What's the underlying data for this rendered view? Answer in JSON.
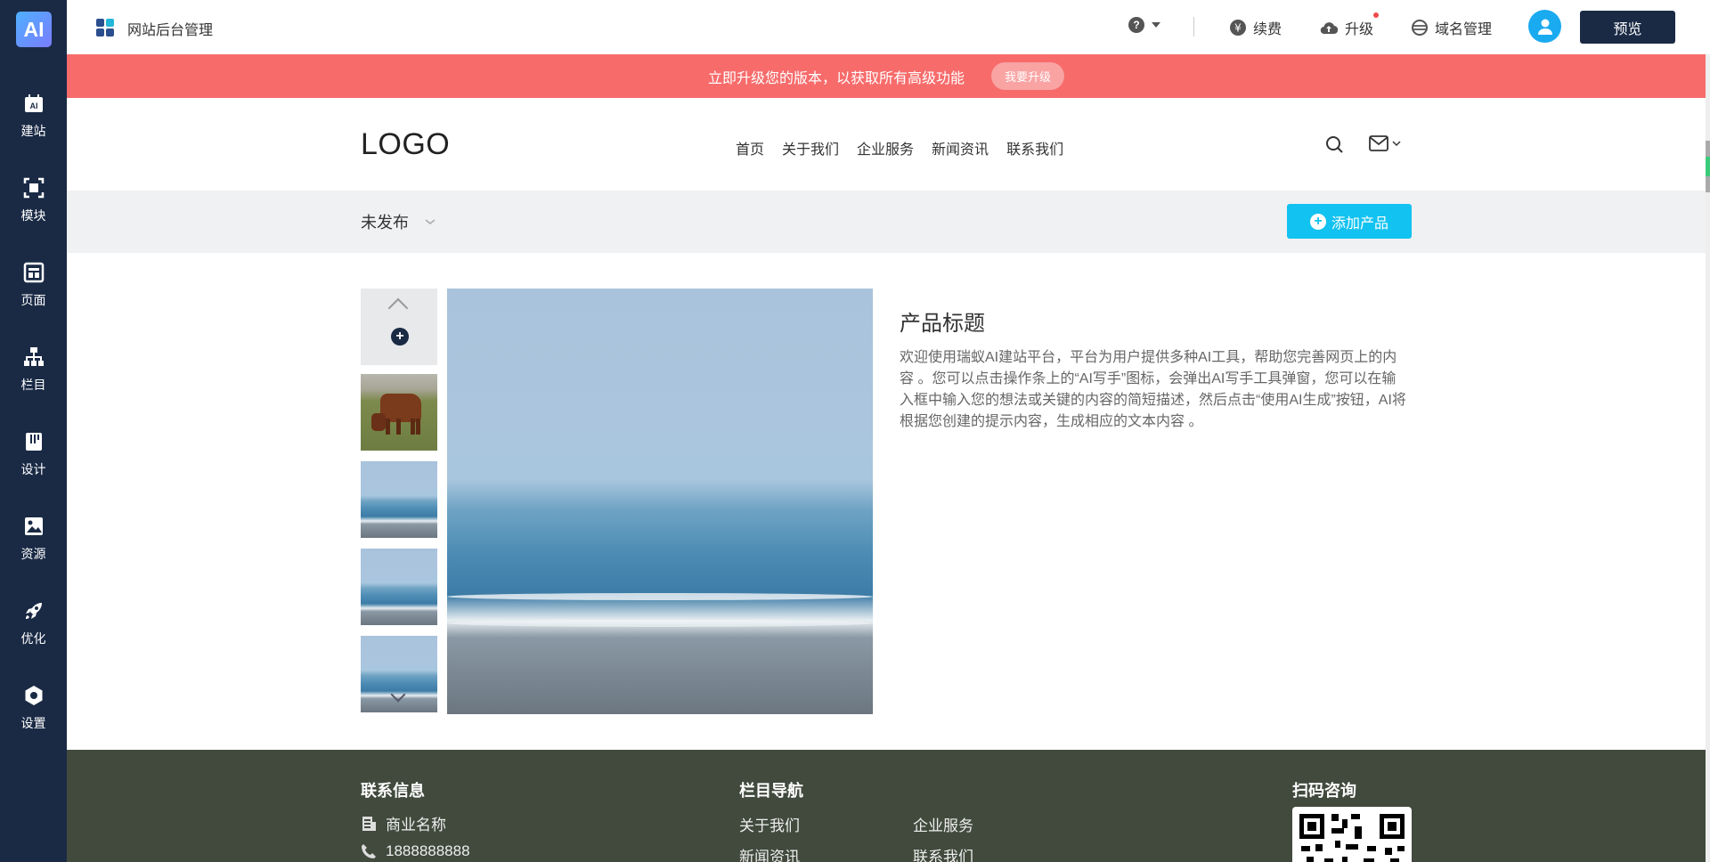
{
  "sidebar": {
    "logo": "AI",
    "items": [
      {
        "label": "建站",
        "icon": "ai-build-icon"
      },
      {
        "label": "模块",
        "icon": "module-icon"
      },
      {
        "label": "页面",
        "icon": "page-icon"
      },
      {
        "label": "栏目",
        "icon": "sitemap-icon"
      },
      {
        "label": "设计",
        "icon": "design-icon"
      },
      {
        "label": "资源",
        "icon": "image-resource-icon"
      },
      {
        "label": "优化",
        "icon": "rocket-icon"
      },
      {
        "label": "设置",
        "icon": "gear-icon"
      }
    ]
  },
  "topbar": {
    "title": "网站后台管理",
    "help": "?",
    "renew": "续费",
    "upgrade": "升级",
    "domain": "域名管理",
    "preview": "预览"
  },
  "banner": {
    "text": "立即升级您的版本，以获取所有高级功能",
    "button": "我要升级"
  },
  "site": {
    "logo": "LOGO",
    "nav": [
      "首页",
      "关于我们",
      "企业服务",
      "新闻资讯",
      "联系我们"
    ]
  },
  "product_bar": {
    "status": "未发布",
    "add_button": "添加产品"
  },
  "product": {
    "title": "产品标题",
    "description": "欢迎使用瑞蚁AI建站平台，平台为用户提供多种AI工具，帮助您完善网页上的内容 。您可以点击操作条上的“AI写手”图标，会弹出AI写手工具弹窗，您可以在输入框中输入您的想法或关键的内容的简短描述，然后点击“使用AI生成”按钮，AI将根据您创建的提示内容，生成相应的文本内容 。"
  },
  "footer": {
    "contact_heading": "联系信息",
    "business_name": "商业名称",
    "phone": "1888888888",
    "nav_heading": "栏目导航",
    "links": [
      "关于我们",
      "企业服务",
      "新闻资讯",
      "联系我们"
    ],
    "qr_heading": "扫码咨询"
  },
  "colors": {
    "sidebar": "#1a2a45",
    "banner": "#f76b6b",
    "accent": "#12c2f0",
    "footer": "#414a3d"
  }
}
